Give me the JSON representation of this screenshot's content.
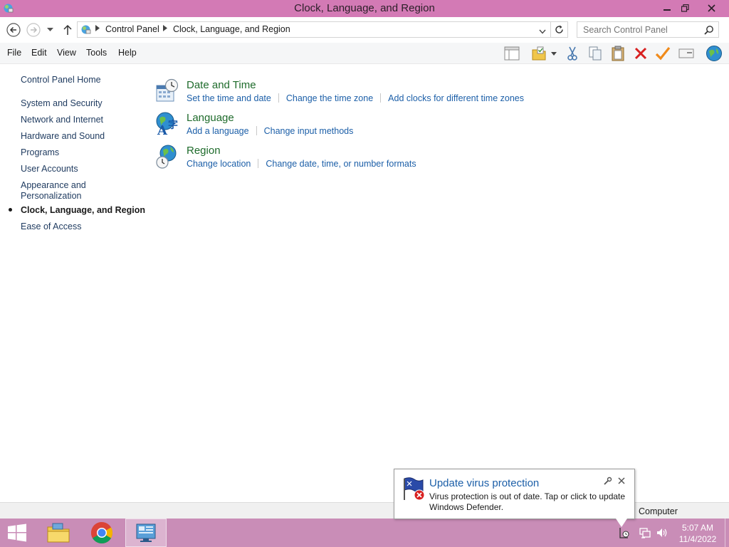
{
  "window": {
    "title": "Clock, Language, and Region",
    "icon": "control-panel-icon",
    "controls": [
      "minimize-icon",
      "restore-icon",
      "close-icon"
    ]
  },
  "address": {
    "crumbs": [
      "Control Panel",
      "Clock, Language, and Region"
    ],
    "search_placeholder": "Search Control Panel"
  },
  "menu": {
    "items": [
      "File",
      "Edit",
      "View",
      "Tools",
      "Help"
    ],
    "toolbar_icons": [
      "layout-icon",
      "folder-options-icon",
      "dropdown-arrow-icon",
      "cut-icon",
      "copy-icon",
      "paste-icon",
      "delete-icon",
      "check-icon",
      "properties-icon",
      "globe-icon"
    ]
  },
  "sidebar": {
    "items": [
      {
        "label": "Control Panel Home"
      },
      {
        "label": "System and Security"
      },
      {
        "label": "Network and Internet"
      },
      {
        "label": "Hardware and Sound"
      },
      {
        "label": "Programs"
      },
      {
        "label": "User Accounts"
      },
      {
        "label": "Appearance and"
      },
      {
        "label": "Personalization"
      },
      {
        "label": "Clock, Language, and Region"
      },
      {
        "label": "Ease of Access"
      }
    ]
  },
  "categories": [
    {
      "title": "Date and Time",
      "icon": "date-time-icon",
      "links": [
        "Set the time and date",
        "Change the time zone",
        "Add clocks for different time zones"
      ]
    },
    {
      "title": "Language",
      "icon": "language-icon",
      "links": [
        "Add a language",
        "Change input methods"
      ]
    },
    {
      "title": "Region",
      "icon": "region-icon",
      "links": [
        "Change location",
        "Change date, time, or number formats"
      ]
    }
  ],
  "statusbar": {
    "text": "Computer"
  },
  "taskbar": {
    "items": [
      "start-icon",
      "file-explorer-icon",
      "chrome-icon",
      "control-panel-icon"
    ],
    "tray": [
      "action-center-icon",
      "network-icon",
      "volume-icon"
    ],
    "time": "5:07 AM",
    "date": "11/4/2022"
  },
  "notification": {
    "title": "Update virus protection",
    "body": "Virus protection is out of date. Tap or click to update Windows Defender.",
    "icon": "defender-warning-icon"
  },
  "colors": {
    "titlebar": "#d37ab5",
    "taskbar": "#c98db7",
    "link": "#1c5fa8",
    "category_title": "#1e6b2b"
  }
}
